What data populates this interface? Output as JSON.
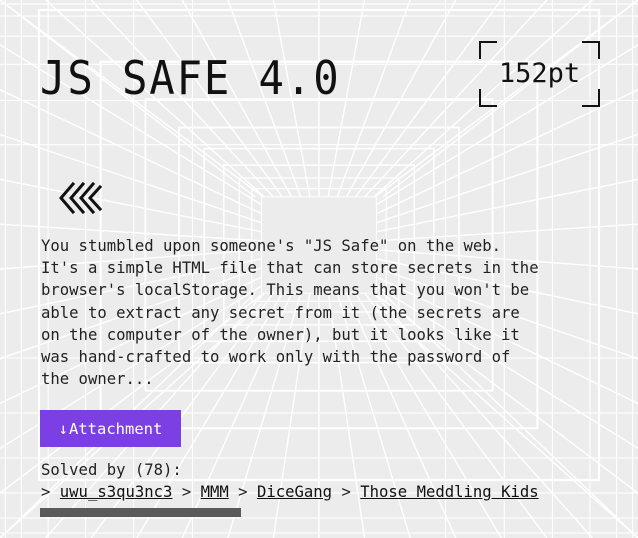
{
  "challenge": {
    "title": "JS SAFE 4.0",
    "points": "152pt",
    "description": "You stumbled upon someone's \"JS Safe\" on the web.\nIt's a simple HTML file that can store secrets in the\nbrowser's localStorage. This means that you won't be\nable to extract any secret from it (the secrets are\non the computer of the owner), but it looks like it\nwas hand-crafted to work only with the password of\nthe owner...",
    "attachment_label": "Attachment",
    "attachment_arrow": "↓",
    "back_icon": "triple-chevron-left-icon",
    "solved_label": "Solved by (78):",
    "solvers": [
      {
        "separator": "> ",
        "name": "uwu_s3qu3nc3"
      },
      {
        "separator": " > ",
        "name": "MMM"
      },
      {
        "separator": " > ",
        "name": "DiceGang"
      },
      {
        "separator": " > ",
        "name": "Those Meddling Kids"
      }
    ]
  },
  "colors": {
    "accent": "#7b3fe4",
    "background": "#ececec",
    "grid_lines": "#ffffff",
    "text": "#111111",
    "scrollbar": "#5a5a5a"
  }
}
